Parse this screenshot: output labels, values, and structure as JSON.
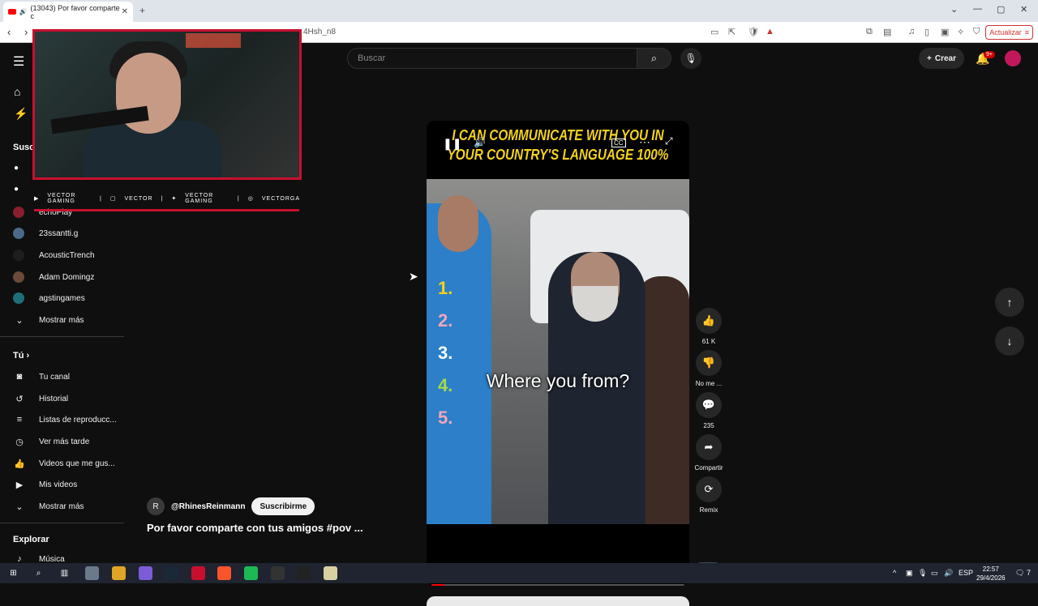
{
  "browser": {
    "tab_title": "(13043) Por favor comparte c",
    "url_fragment": "4Hsh_n8",
    "update_label": "Actualizar"
  },
  "header": {
    "search_placeholder": "Buscar",
    "create_label": "Crear",
    "notifications_badge": "9+"
  },
  "sidebar": {
    "subscriptions_heading": "Susc",
    "channels": [
      {
        "name": "echoPlay",
        "color": "#8b1e2e"
      },
      {
        "name": "23ssantti.g",
        "color": "#4b6a8a"
      },
      {
        "name": "AcousticTrench",
        "color": "#1e1e1e"
      },
      {
        "name": "Adam Domingz",
        "color": "#6b4a3a"
      },
      {
        "name": "agstingames",
        "color": "#1f6f7a"
      }
    ],
    "show_more_1": "Mostrar más",
    "you_heading": "Tú",
    "you_items": [
      "Tu canal",
      "Historial",
      "Listas de reproducc...",
      "Ver más tarde",
      "Videos que me gus...",
      "Mis videos"
    ],
    "show_more_2": "Mostrar más",
    "explore_heading": "Explorar",
    "explore_items": [
      "Música"
    ]
  },
  "overlay": {
    "socials": [
      "VECTOR GAMING",
      "VECTOR",
      "VECTOR GAMING",
      "VECTORGA"
    ]
  },
  "video": {
    "top_caption_line1": "I CAN COMMUNICATE WITH YOU IN",
    "top_caption_line2": "YOUR COUNTRY'S LANGUAGE 100%",
    "numbers": [
      "1.",
      "2.",
      "3.",
      "4.",
      "5."
    ],
    "number_colors": [
      "#f5d21b",
      "#f0a6b8",
      "#ffffff",
      "#a6d84a",
      "#f0a6b8"
    ],
    "subtitle": "Where you from?",
    "progress": 0.05
  },
  "actions": {
    "likes": "61 K",
    "dislike": "No me ...",
    "comments": "235",
    "share": "Compartir",
    "remix": "Remix",
    "channel_initial": "R"
  },
  "channel": {
    "initial": "R",
    "name": "@RhinesReinmann",
    "subscribe_label": "Suscribirme",
    "video_title": "Por favor comparte con tus amigos #pov ..."
  },
  "taskbar": {
    "lang": "ESP",
    "time": "22:57",
    "date": "29/4/2026",
    "notif_count": "7"
  }
}
